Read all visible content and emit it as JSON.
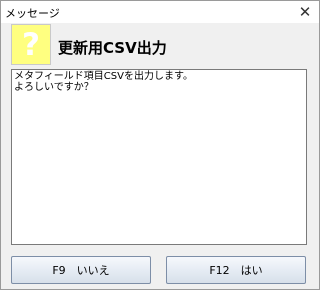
{
  "window": {
    "title": "メッセージ",
    "close_symbol": "✕"
  },
  "header": {
    "icon_symbol": "?",
    "icon_color": "#ffff80",
    "title": "更新用CSV出力"
  },
  "message": {
    "lines": [
      "メタフィールド項目CSVを出力します。",
      "よろしいですか？"
    ]
  },
  "buttons": {
    "no_label": "F9　いいえ",
    "yes_label": "F12　はい"
  }
}
